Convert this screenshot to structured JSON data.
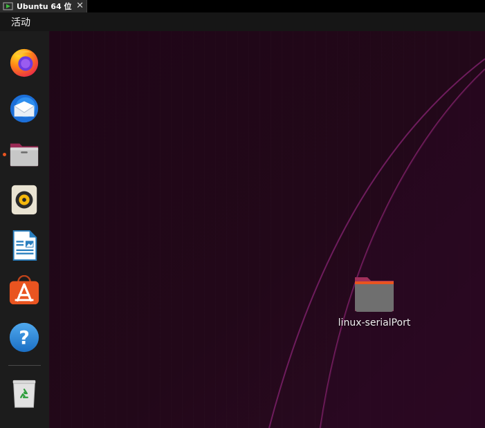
{
  "vm_tab": {
    "title": "Ubuntu 64 位",
    "close_glyph": "✕"
  },
  "topbar": {
    "activities": "活动"
  },
  "dock": {
    "items": [
      {
        "name": "firefox-icon",
        "running": false
      },
      {
        "name": "thunderbird-icon",
        "running": false
      },
      {
        "name": "files-icon",
        "running": true
      },
      {
        "name": "rhythmbox-icon",
        "running": false
      },
      {
        "name": "libreoffice-writer-icon",
        "running": false
      },
      {
        "name": "ubuntu-software-icon",
        "running": false
      },
      {
        "name": "help-icon",
        "running": false
      },
      {
        "name": "trash-icon",
        "running": false
      }
    ]
  },
  "desktop": {
    "icons": [
      {
        "label": "linux-serialPort",
        "icon": "folder-icon"
      }
    ]
  },
  "colors": {
    "accent": "#e95420",
    "desktop_bg": "#220819",
    "wave": "#8a2470"
  }
}
